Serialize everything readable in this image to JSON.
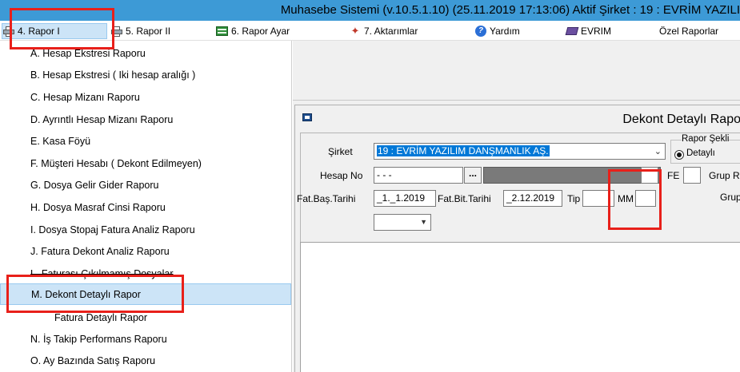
{
  "window": {
    "title": "Muhasebe Sistemi (v.10.5.1.10) (25.11.2019 17:13:06) Aktif Şirket : 19 : EVRİM YAZILI"
  },
  "menubar": {
    "items": [
      {
        "label": "4.  Rapor I",
        "icon": "printer-icon"
      },
      {
        "label": "5.  Rapor II",
        "icon": "printer-icon"
      },
      {
        "label": "6.  Rapor Ayar",
        "icon": "settings-icon"
      },
      {
        "label": "7.  Aktarımlar",
        "icon": "transfer-icon"
      },
      {
        "label": "Yardım",
        "icon": "help-icon"
      },
      {
        "label": "EVRIM",
        "icon": "evrim-icon"
      },
      {
        "label": "Özel Raporlar",
        "icon": ""
      }
    ]
  },
  "dropdown": {
    "items": [
      {
        "label": "A.   Hesap Ekstresi Raporu"
      },
      {
        "label": "B.   Hesap Ekstresi ( Iki hesap aralığı )"
      },
      {
        "label": "C.   Hesap Mizanı Raporu"
      },
      {
        "label": "D.   Ayrıntlı Hesap Mizanı Raporu"
      },
      {
        "label": "E.   Kasa Föyü"
      },
      {
        "label": "F.   Müşteri Hesabı ( Dekont Edilmeyen)"
      },
      {
        "label": "G.   Dosya Gelir Gider Raporu"
      },
      {
        "label": "H.   Dosya Masraf Cinsi Raporu"
      },
      {
        "label": "I.   Dosya Stopaj Fatura Analiz Raporu"
      },
      {
        "label": "J.   Fatura Dekont Analiz Raporu"
      },
      {
        "label": "L.   Faturası Çıkılmamış Dosyalar"
      },
      {
        "label": "M.   Dekont Detaylı Rapor"
      },
      {
        "label": "Fatura Detaylı Rapor"
      },
      {
        "label": "N.   İş Takip Performans Raporu"
      },
      {
        "label": "O.   Ay Bazında Satış Raporu"
      }
    ]
  },
  "child_window": {
    "title": "Dekont Detaylı Rapo",
    "sirket_label": "Şirket",
    "sirket_value": "19 : EVRİM YAZILIM DANŞMANLIK AŞ.",
    "rapor_sekli_label": "Rapor Şekli",
    "detayli_label": "Detaylı",
    "hesap_no_label": "Hesap No",
    "hesap_no_value": "  -  -  -",
    "dots_label": "...",
    "fe_label": "FE",
    "grup_r_label": "Grup R",
    "grup_label": "Grup",
    "fat_bas_label": "Fat.Baş.Tarihi",
    "fat_bas_value": "_1._1.2019",
    "fat_bit_label": "Fat.Bit.Tarihi",
    "fat_bit_value": "_2.12.2019",
    "tip_label": "Tip",
    "mm_label": "MM"
  },
  "colors": {
    "titlebar": "#3d9ad6",
    "selection": "#cce4f7",
    "annotation": "#e8201a"
  }
}
